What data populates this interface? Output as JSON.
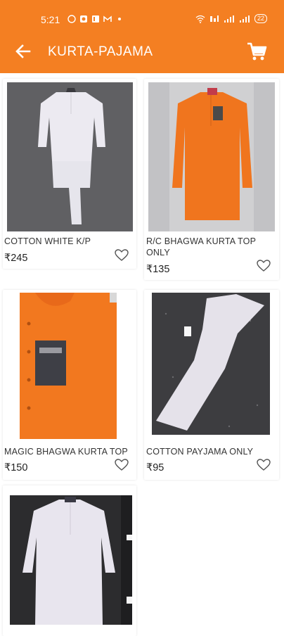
{
  "status_bar": {
    "time": "5:21",
    "battery": "22"
  },
  "app_bar": {
    "title": "KURTA-PAJAMA"
  },
  "products": [
    {
      "name": "COTTON WHITE K/P",
      "price": "₹245"
    },
    {
      "name": "R/C BHAGWA KURTA TOP ONLY",
      "price": "₹135"
    },
    {
      "name": "MAGIC BHAGWA KURTA TOP",
      "price": "₹150"
    },
    {
      "name": "COTTON PAYJAMA ONLY",
      "price": "₹95"
    },
    {
      "name": "",
      "price": ""
    }
  ],
  "colors": {
    "brand": "#f47f22",
    "white_cloth": "#e9e8ef",
    "orange_cloth": "#f0751e"
  }
}
